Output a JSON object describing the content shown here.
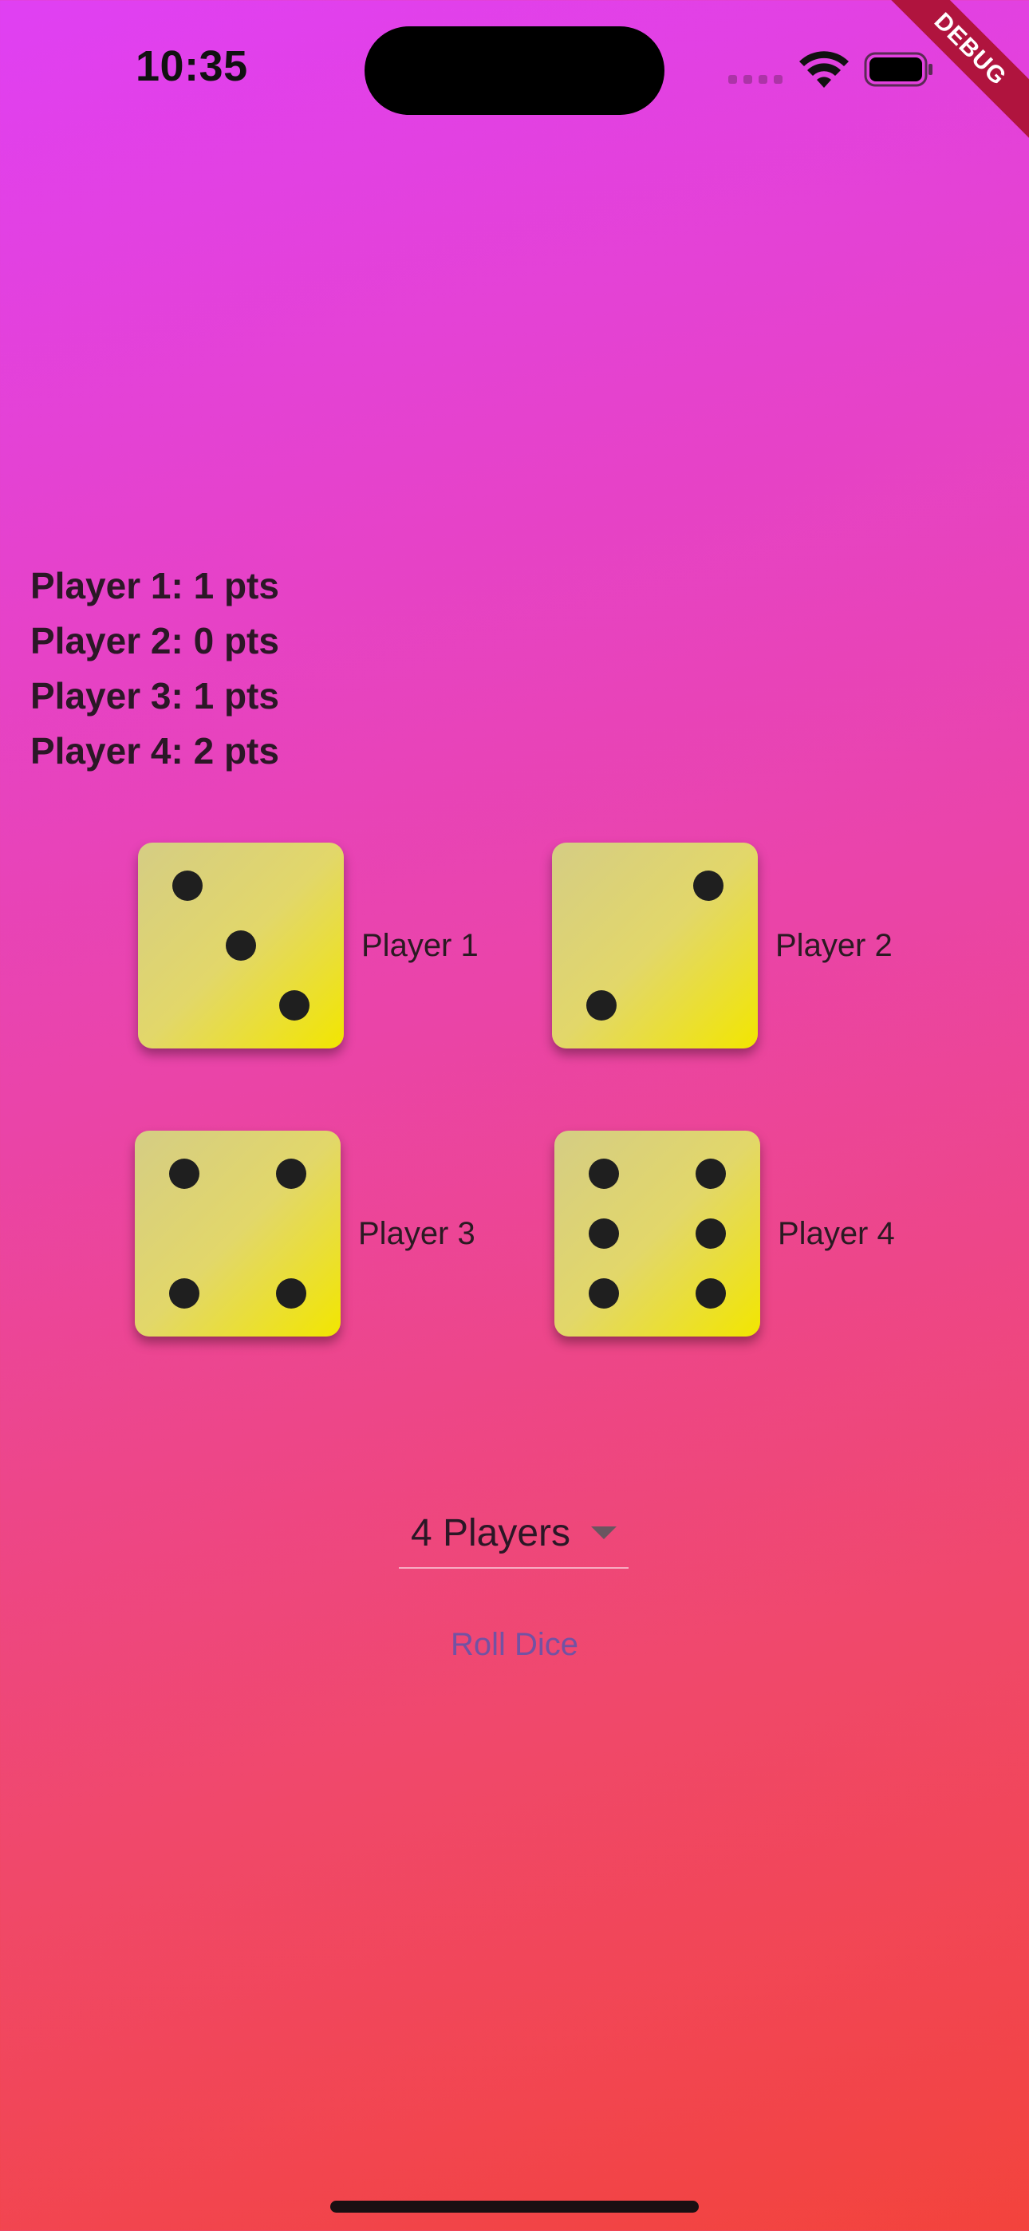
{
  "status_bar": {
    "time": "10:35"
  },
  "debug_banner": "DEBUG",
  "scores": [
    "Player 1: 1 pts",
    "Player 2: 0 pts",
    "Player 3: 1 pts",
    "Player 4: 2 pts"
  ],
  "players": [
    {
      "label": "Player 1",
      "die_value": 3
    },
    {
      "label": "Player 2",
      "die_value": 2
    },
    {
      "label": "Player 3",
      "die_value": 4
    },
    {
      "label": "Player 4",
      "die_value": 6
    }
  ],
  "player_count_select": {
    "value": "4 Players"
  },
  "roll_button_label": "Roll Dice",
  "colors": {
    "die_face": "#e2d76a",
    "pip": "#1f1f1f",
    "roll_button_text": "#7352a3",
    "debug_banner": "#b0143e"
  }
}
